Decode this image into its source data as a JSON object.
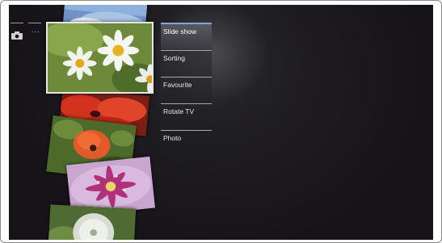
{
  "status": {
    "camera_icon": "camera-icon",
    "dots": "..."
  },
  "photos": [
    {
      "subject": "sky"
    },
    {
      "subject": "daisies"
    },
    {
      "subject": "red-flowers"
    },
    {
      "subject": "poppy"
    },
    {
      "subject": "pink-flower"
    },
    {
      "subject": "dandelion"
    }
  ],
  "menu": {
    "selected_index": 0,
    "items": [
      {
        "label": "Slide show"
      },
      {
        "label": "Sorting"
      },
      {
        "label": "Favourite"
      },
      {
        "label": "Rotate TV"
      },
      {
        "label": "Photo"
      }
    ]
  },
  "colors": {
    "background": "#161419",
    "menu_text": "#e8e8ea",
    "selected_accent": "#7fa6d6"
  }
}
